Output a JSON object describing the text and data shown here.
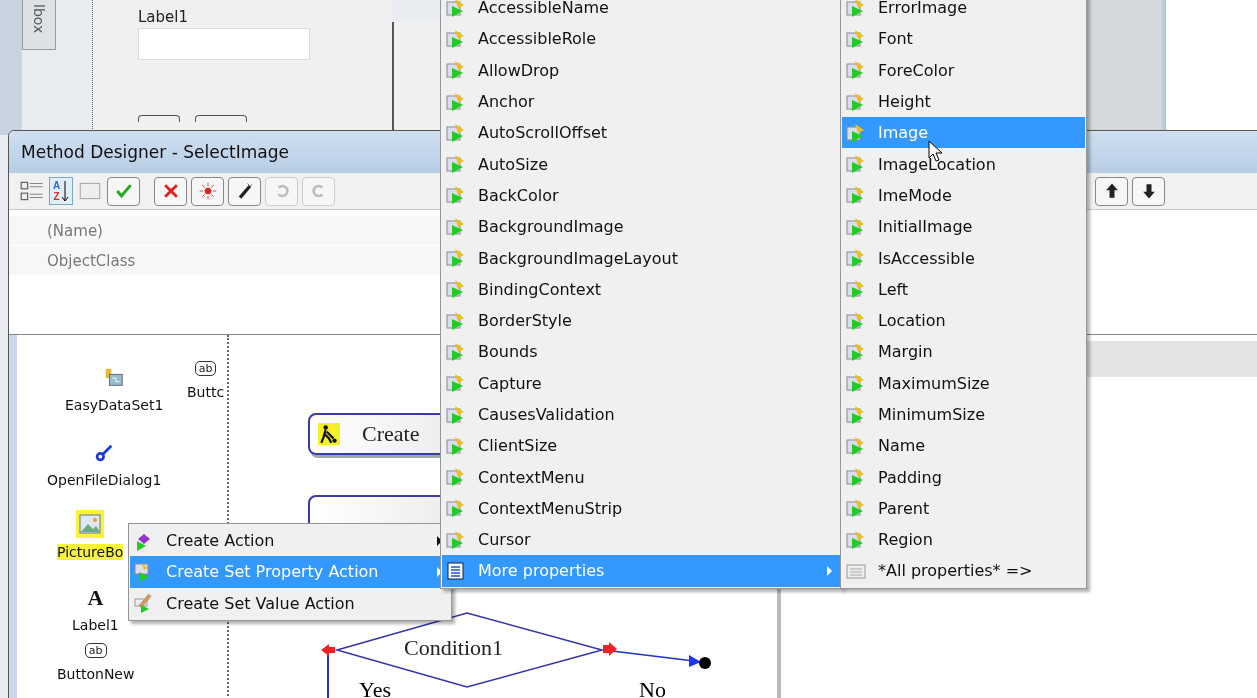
{
  "ide": {
    "toolbox_tab": "lbox",
    "form_label": "Label1"
  },
  "method_designer": {
    "title": "Method Designer - SelectImage",
    "sort_letters": [
      "A",
      "Z"
    ],
    "properties": [
      {
        "name": "(Name)"
      },
      {
        "name": "ObjectClass"
      }
    ],
    "components": [
      {
        "label": "EasyDataSet1",
        "kind": "dataset",
        "selected": false
      },
      {
        "label": "Buttc",
        "kind": "button",
        "icon_text": "ab",
        "selected": false
      },
      {
        "label": "OpenFileDialog1",
        "kind": "dialog",
        "selected": false
      },
      {
        "label": "PictureBo",
        "kind": "picture",
        "selected": true
      },
      {
        "label": "Label1",
        "kind": "label",
        "icon_text": "A",
        "selected": false
      },
      {
        "label": "ButtonNew",
        "kind": "button",
        "icon_text": "ab",
        "selected": false
      }
    ],
    "diagram": {
      "action_node": "Create",
      "condition": "Condition1",
      "yes_label": "Yes",
      "no_label": "No"
    }
  },
  "context_menu": [
    {
      "label": "Create Action",
      "kind": "action",
      "submenu": true,
      "selected": false
    },
    {
      "label": "Create Set Property Action",
      "kind": "property",
      "submenu": true,
      "selected": true
    },
    {
      "label": "Create Set Value Action",
      "kind": "value",
      "submenu": false,
      "selected": false
    }
  ],
  "properties_menu": [
    {
      "label": "AccessibleName",
      "kind": "property",
      "submenu": false,
      "selected": false
    },
    {
      "label": "AccessibleRole",
      "kind": "property",
      "submenu": false,
      "selected": false
    },
    {
      "label": "AllowDrop",
      "kind": "property",
      "submenu": false,
      "selected": false
    },
    {
      "label": "Anchor",
      "kind": "property",
      "submenu": false,
      "selected": false
    },
    {
      "label": "AutoScrollOffset",
      "kind": "property",
      "submenu": false,
      "selected": false
    },
    {
      "label": "AutoSize",
      "kind": "property",
      "submenu": false,
      "selected": false
    },
    {
      "label": "BackColor",
      "kind": "property",
      "submenu": false,
      "selected": false
    },
    {
      "label": "BackgroundImage",
      "kind": "property",
      "submenu": false,
      "selected": false
    },
    {
      "label": "BackgroundImageLayout",
      "kind": "property",
      "submenu": false,
      "selected": false
    },
    {
      "label": "BindingContext",
      "kind": "property",
      "submenu": false,
      "selected": false
    },
    {
      "label": "BorderStyle",
      "kind": "property",
      "submenu": false,
      "selected": false
    },
    {
      "label": "Bounds",
      "kind": "property",
      "submenu": false,
      "selected": false
    },
    {
      "label": "Capture",
      "kind": "property",
      "submenu": false,
      "selected": false
    },
    {
      "label": "CausesValidation",
      "kind": "property",
      "submenu": false,
      "selected": false
    },
    {
      "label": "ClientSize",
      "kind": "property",
      "submenu": false,
      "selected": false
    },
    {
      "label": "ContextMenu",
      "kind": "property",
      "submenu": false,
      "selected": false
    },
    {
      "label": "ContextMenuStrip",
      "kind": "property",
      "submenu": false,
      "selected": false
    },
    {
      "label": "Cursor",
      "kind": "property",
      "submenu": false,
      "selected": false
    },
    {
      "label": "More properties",
      "kind": "more",
      "submenu": true,
      "selected": true
    }
  ],
  "more_properties_menu": [
    {
      "label": "ErrorImage",
      "kind": "property",
      "selected": false
    },
    {
      "label": "Font",
      "kind": "property",
      "selected": false
    },
    {
      "label": "ForeColor",
      "kind": "property",
      "selected": false
    },
    {
      "label": "Height",
      "kind": "property",
      "selected": false
    },
    {
      "label": "Image",
      "kind": "property",
      "selected": true
    },
    {
      "label": "ImageLocation",
      "kind": "property",
      "selected": false
    },
    {
      "label": "ImeMode",
      "kind": "property",
      "selected": false
    },
    {
      "label": "InitialImage",
      "kind": "property",
      "selected": false
    },
    {
      "label": "IsAccessible",
      "kind": "property",
      "selected": false
    },
    {
      "label": "Left",
      "kind": "property",
      "selected": false
    },
    {
      "label": "Location",
      "kind": "property",
      "selected": false
    },
    {
      "label": "Margin",
      "kind": "property",
      "selected": false
    },
    {
      "label": "MaximumSize",
      "kind": "property",
      "selected": false
    },
    {
      "label": "MinimumSize",
      "kind": "property",
      "selected": false
    },
    {
      "label": "Name",
      "kind": "property",
      "selected": false
    },
    {
      "label": "Padding",
      "kind": "property",
      "selected": false
    },
    {
      "label": "Parent",
      "kind": "property",
      "selected": false
    },
    {
      "label": "Region",
      "kind": "property",
      "selected": false
    },
    {
      "label": "*All properties* =>",
      "kind": "all",
      "selected": false
    }
  ]
}
